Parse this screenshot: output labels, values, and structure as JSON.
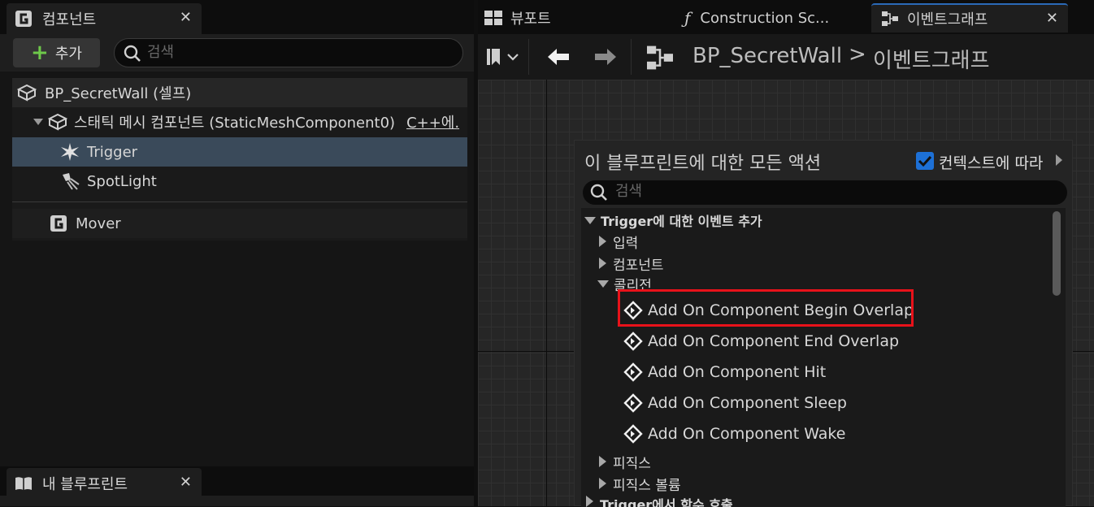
{
  "components_panel": {
    "tab_title": "컴포넌트",
    "add_label": "추가",
    "search_placeholder": "검색",
    "tree": [
      {
        "label": "BP_SecretWall (셀프)"
      },
      {
        "label": "스태틱 메시 컴포넌트 (StaticMeshComponent0)",
        "extra": "C++에."
      },
      {
        "label": "Trigger"
      },
      {
        "label": "SpotLight"
      },
      {
        "label": "Mover"
      }
    ]
  },
  "my_blueprint_panel": {
    "tab_title": "내 블루프린트"
  },
  "editor_tabs": [
    {
      "label": "뷰포트"
    },
    {
      "label": "Construction Sc..."
    },
    {
      "label": "이벤트그래프"
    }
  ],
  "breadcrumb": {
    "blueprint": "BP_SecretWall",
    "separator": ">",
    "graph": "이벤트그래프"
  },
  "action_menu": {
    "title": "이 블루프린트에 대한 모든 액션",
    "context_label": "컨텍스트에 따라",
    "context_checked": true,
    "search_placeholder": "검색",
    "categories": {
      "trigger_events": "Trigger에 대한 이벤트 추가",
      "input": "입력",
      "component": "컴포넌트",
      "collision": "콜리전",
      "physics": "피직스",
      "physics_volume": "피직스 볼륨",
      "trigger_functions": "Trigger에서 함수 호출"
    },
    "collision_actions": [
      "Add On Component Begin Overlap",
      "Add On Component End Overlap",
      "Add On Component Hit",
      "Add On Component Sleep",
      "Add On Component Wake"
    ],
    "highlighted": "Add On Component Begin Overlap",
    "highlight_color": "#e8121a"
  },
  "colors": {
    "accent": "#1d70d6",
    "selected_row": "#3a4a5a",
    "add_plus": "#6ec94a"
  }
}
